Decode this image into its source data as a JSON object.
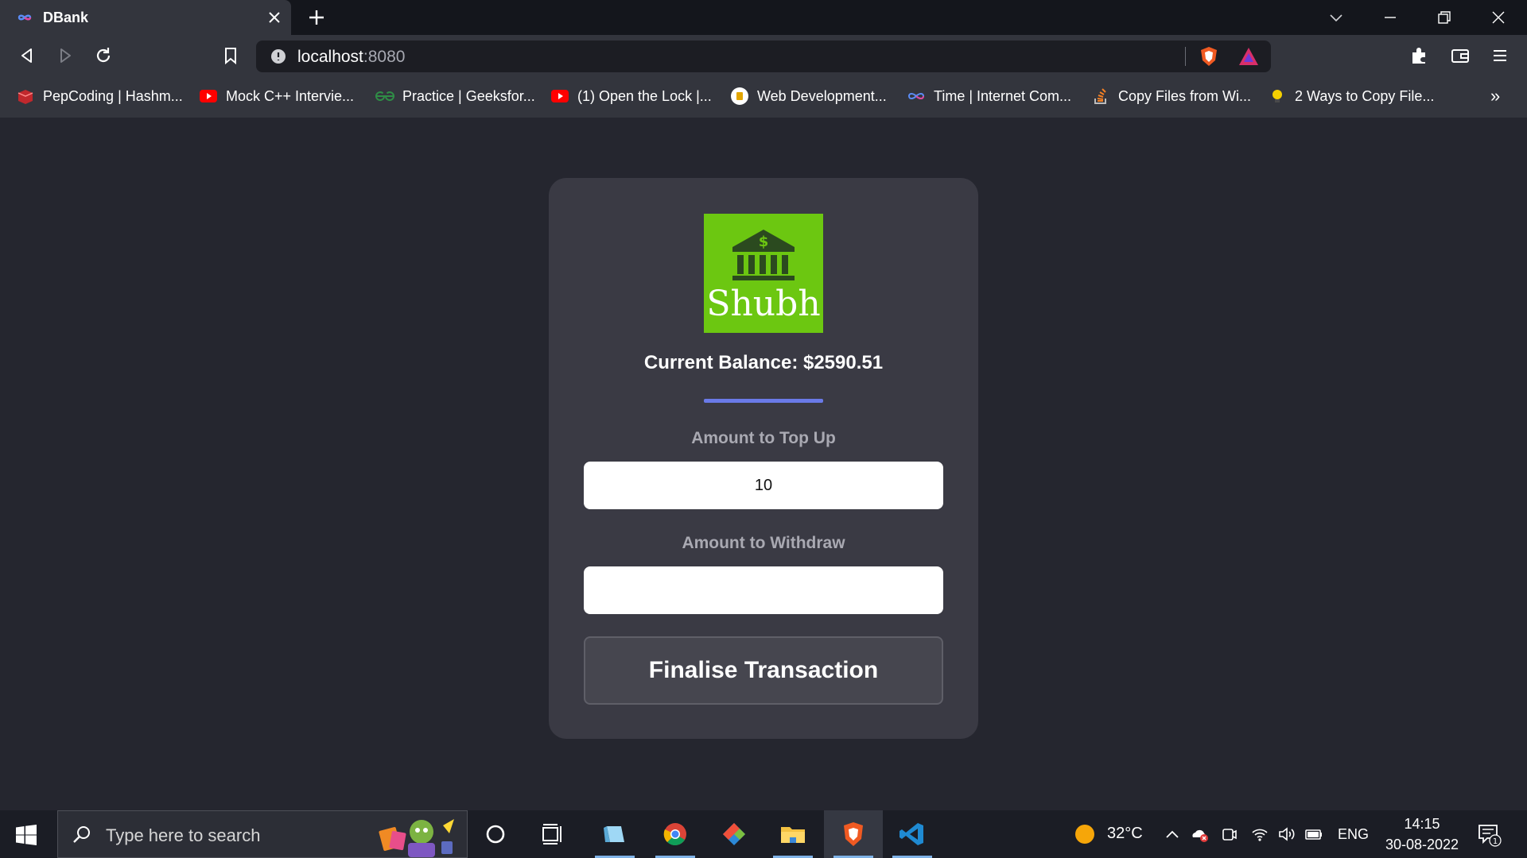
{
  "browser": {
    "tab_title": "DBank",
    "url_host": "localhost",
    "url_port": ":8080",
    "bookmarks": [
      {
        "label": "PepCoding | Hashm...",
        "icon": "pepcoding-icon"
      },
      {
        "label": "Mock C++ Intervie...",
        "icon": "youtube-icon"
      },
      {
        "label": "Practice | Geeksfor...",
        "icon": "geeksforgeeks-icon"
      },
      {
        "label": "(1) Open the Lock |...",
        "icon": "youtube-icon"
      },
      {
        "label": "Web Development...",
        "icon": "web-dev-icon"
      },
      {
        "label": "Time | Internet Com...",
        "icon": "infinity-icon"
      },
      {
        "label": "Copy Files from Wi...",
        "icon": "stackoverflow-icon"
      },
      {
        "label": "2 Ways to Copy File...",
        "icon": "lightbulb-icon"
      }
    ],
    "bookmarks_more": "»"
  },
  "app": {
    "logo_text": "Shubh",
    "balance_text": "Current Balance: $2590.51",
    "topup_label": "Amount to Top Up",
    "topup_value": "10",
    "withdraw_label": "Amount to Withdraw",
    "withdraw_value": "",
    "button_label": "Finalise Transaction"
  },
  "taskbar": {
    "search_placeholder": "Type here to search",
    "temperature": "32°C",
    "language": "ENG",
    "time": "14:15",
    "date": "30-08-2022",
    "notification_count": "1"
  },
  "colors": {
    "page_bg": "#25262f",
    "card_bg": "#3a3a44",
    "logo_green": "#6cc711",
    "divider_blue": "#6a7ae8",
    "chrome_bg": "#33353d"
  }
}
